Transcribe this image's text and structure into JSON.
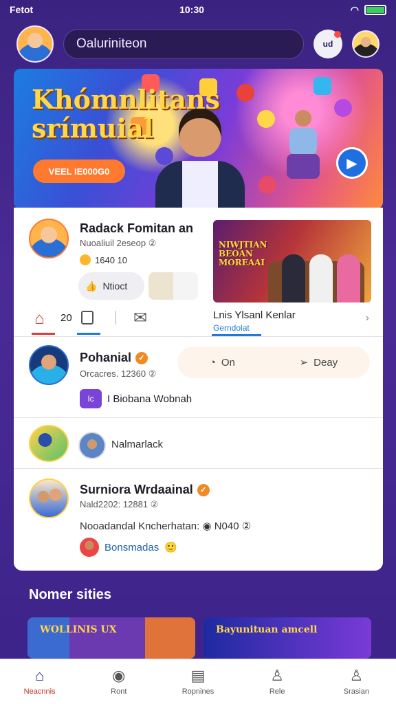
{
  "status": {
    "carrier": "Fetot",
    "time": "10:30",
    "battery_percent": 100
  },
  "top": {
    "search_text": "Oaluriniteon",
    "notif_badge": "ud"
  },
  "banner": {
    "title_line1": "Khómnlitans",
    "title_line2": "srímuial",
    "cta": "VEEL IE000G0"
  },
  "post1": {
    "name": "Radack Fomitan an",
    "meta": "Nuoaliuil 2eseop ②",
    "stat": "1640 10",
    "share_label": "Ntioct",
    "side_image_text": "NIWJTIAN BEOAN MOREAAI",
    "tab_count": "20",
    "tab_title": "Lnis  Ylsanl Kenlar",
    "tab_sub": "Gerndolat"
  },
  "post2": {
    "name": "Pohanial",
    "meta": "Orcacres. 12360 ②",
    "action1": "On",
    "action2": "Deay",
    "group_badge": "Ic",
    "group_name": "I Biobana Wobnah"
  },
  "post3": {
    "text": "Nalmarlack"
  },
  "post4": {
    "name": "Surniora Wrdaainal",
    "meta": "Nald2202: 12881 ②",
    "desc": "Nooadandal Kncherhatan: ◉ N040 ②",
    "link": "Bonsmadas"
  },
  "section": {
    "title": "Nomer sities"
  },
  "stories": [
    {
      "label": "WOLLINIS UX"
    },
    {
      "label": "Bayunituan amcell"
    }
  ],
  "nav": [
    {
      "label": "Neacnnis",
      "icon": "home-icon",
      "glyph": "⌂"
    },
    {
      "label": "Ront",
      "icon": "camera-icon",
      "glyph": "◉"
    },
    {
      "label": "Ropnines",
      "icon": "document-icon",
      "glyph": "▤"
    },
    {
      "label": "Rele",
      "icon": "person-icon",
      "glyph": "♙"
    },
    {
      "label": "Srasian",
      "icon": "profile-icon",
      "glyph": "♙"
    }
  ]
}
